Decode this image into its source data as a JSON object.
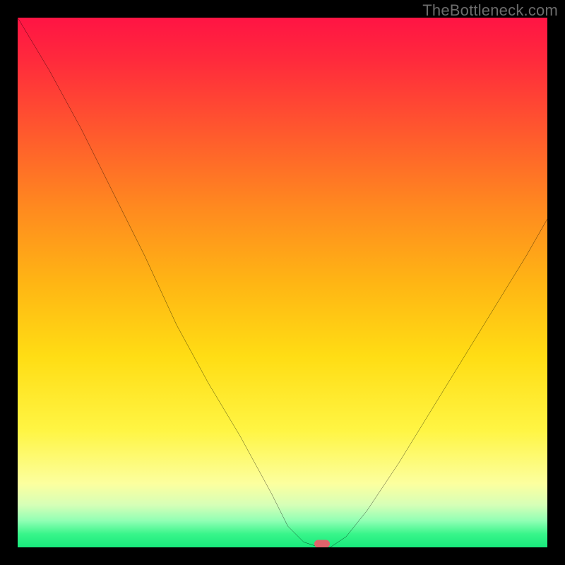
{
  "watermark": "TheBottleneck.com",
  "chart_data": {
    "type": "line",
    "title": "",
    "xlabel": "",
    "ylabel": "",
    "xlim": [
      0,
      100
    ],
    "ylim": [
      0,
      100
    ],
    "grid": false,
    "legend": false,
    "gradient_stops": [
      {
        "pos": 0,
        "color": "#ff1444"
      },
      {
        "pos": 8,
        "color": "#ff2a3c"
      },
      {
        "pos": 22,
        "color": "#ff5a2d"
      },
      {
        "pos": 36,
        "color": "#ff8a1f"
      },
      {
        "pos": 50,
        "color": "#ffb514"
      },
      {
        "pos": 64,
        "color": "#ffdd14"
      },
      {
        "pos": 78,
        "color": "#fff544"
      },
      {
        "pos": 88,
        "color": "#fcff9f"
      },
      {
        "pos": 92,
        "color": "#d6ffb7"
      },
      {
        "pos": 95,
        "color": "#90ffb4"
      },
      {
        "pos": 97.5,
        "color": "#38f58a"
      },
      {
        "pos": 100,
        "color": "#18e97c"
      }
    ],
    "series": [
      {
        "name": "bottleneck-curve",
        "x": [
          0,
          6,
          12,
          18,
          24,
          30,
          36,
          42,
          48,
          51,
          54,
          57,
          59,
          62,
          66,
          72,
          80,
          88,
          96,
          100
        ],
        "y": [
          100,
          90,
          79,
          67,
          55,
          42,
          31,
          21,
          10,
          4,
          1,
          0,
          0,
          2,
          7,
          16,
          29,
          42,
          55,
          62
        ]
      }
    ],
    "marker": {
      "x": 57.5,
      "y": 0,
      "color": "#e0636b"
    }
  }
}
